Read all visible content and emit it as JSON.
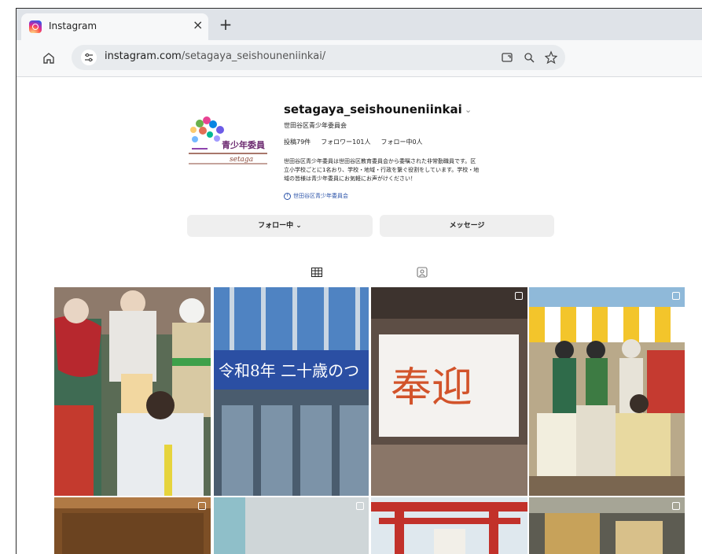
{
  "browser": {
    "tab_title": "Instagram",
    "tab_close": "×",
    "new_tab": "+",
    "url_host": "instagram.com",
    "url_path": "/setagaya_seishouneniinkai/"
  },
  "profile": {
    "username": "setagaya_seishouneniinkai",
    "username_chevron": "⌄",
    "full_name": "世田谷区青少年委員会",
    "stats": {
      "posts": "投稿79件",
      "followers": "フォロワー101人",
      "following": "フォロー中0人"
    },
    "bio_line1": "世田谷区青少年委員は世田谷区教育委員会から委嘱された非常勤職員です。区",
    "bio_line2": "立小学校ごとに1名おり、学校・地域・行政を繋ぐ役割をしています。学校・地",
    "bio_line3": "域の皆様は青少年委員にお気軽にお声がけください！",
    "link_text": "世田谷区青少年委員会",
    "logo_text": "青少年委員",
    "logo_subtext": "setaga"
  },
  "actions": {
    "follow_label": "フォロー中 ⌄",
    "message_label": "メッセージ"
  },
  "photo_grid": {
    "photo2_banner": "令和8年 二十歳のつ",
    "photo3_text": "奉迎"
  },
  "colors": {
    "link": "#2a52a8",
    "button_bg": "#efefef",
    "tabbar_bg": "#dfe3e8"
  }
}
